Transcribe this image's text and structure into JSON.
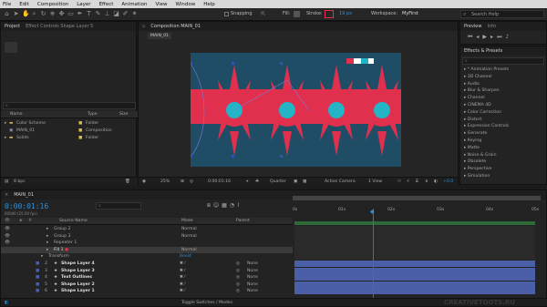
{
  "menu": [
    "File",
    "Edit",
    "Composition",
    "Layer",
    "Effect",
    "Animation",
    "View",
    "Window",
    "Help"
  ],
  "toolbar": {
    "snapping": "Snapping",
    "fill": "Fill:",
    "stroke": "Stroke:",
    "stroke_width": "19 px",
    "workspace_label": "Workspace:",
    "workspace_value": "MyFirst",
    "search_placeholder": "Search Help"
  },
  "project": {
    "tab": "Project",
    "effect_controls": "Effect Controls Shape Layer 5",
    "columns": [
      "Name",
      "Type",
      "Size"
    ],
    "items": [
      {
        "name": "Color Scheme",
        "type": "Folder"
      },
      {
        "name": "MAIN_01",
        "type": "Composition"
      },
      {
        "name": "Solids",
        "type": "Folder"
      }
    ],
    "bpc": "8 bpc"
  },
  "composition": {
    "tab": "Composition MAIN_01",
    "subtab": "MAIN_01",
    "zoom": "25%",
    "timecode": "0:00:01:16",
    "resolution": "Quarter",
    "camera": "Active Camera",
    "views": "1 View",
    "exposure": "+0.0"
  },
  "preview": {
    "tab": "Preview",
    "info_tab": "Info"
  },
  "effects": {
    "tab": "Effects & Presets",
    "search_placeholder": "",
    "items": [
      "* Animation Presets",
      "3D Channel",
      "Audio",
      "Blur & Sharpen",
      "Channel",
      "CINEMA 4D",
      "Color Correction",
      "Distort",
      "Expression Controls",
      "Generate",
      "Keying",
      "Matte",
      "Noise & Grain",
      "Obsolete",
      "Perspective",
      "Simulation"
    ]
  },
  "timeline": {
    "tab": "MAIN_01",
    "timecode": "0:00:01:16",
    "fps": "00040 (25.00 fps)",
    "col_source": "Source Name",
    "col_parent": "Parent",
    "mode_label": "Mode",
    "ruler": [
      "0s",
      "01s",
      "02s",
      "03s",
      "04s",
      "05s"
    ],
    "props": [
      {
        "name": "Group 2",
        "mode": "Normal"
      },
      {
        "name": "Group 3",
        "mode": "Normal"
      },
      {
        "name": "Repeater 1",
        "mode": ""
      },
      {
        "name": "Fill 1",
        "mode": "Normal"
      }
    ],
    "transform": "Transform",
    "reset": "Reset",
    "layers": [
      {
        "num": "2",
        "name": "Shape Layer 4",
        "parent": "None"
      },
      {
        "num": "3",
        "name": "Shape Layer 3",
        "parent": "None"
      },
      {
        "num": "4",
        "name": "Text Outlines",
        "parent": "None"
      },
      {
        "num": "5",
        "name": "Shape Layer 2",
        "parent": "None"
      },
      {
        "num": "6",
        "name": "Shape Layer 1",
        "parent": "None"
      }
    ],
    "toggle": "Toggle Switches / Modes"
  },
  "watermark": "CREATIVETOOTS.RU",
  "colors": {
    "accent": "#2f8fd6",
    "canvas": "#1f4d66",
    "gear": "#e0304e",
    "teal": "#23b4c6",
    "layerbar": "#4a5fa8",
    "playhead": "#e0304e"
  }
}
